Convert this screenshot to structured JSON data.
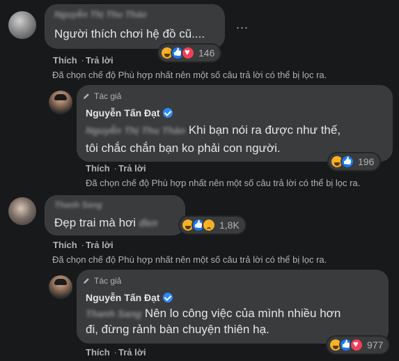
{
  "comments": [
    {
      "author": "Nguyễn Thị Thu Thảo",
      "text": "Người thích chơi hệ đồ cũ....",
      "reactions": [
        "haha",
        "like",
        "love"
      ],
      "reaction_count": "146",
      "actions": {
        "like": "Thích",
        "reply": "Trả lời"
      },
      "filter_note": "Đã chọn chế độ Phù hợp nhất nên một số câu trả lời có thể bị lọc ra.",
      "more": "...",
      "reply": {
        "badge": "Tác giả",
        "author": "Nguyễn Tấn Đạt",
        "mention": "Nguyễn Thị Thu Thảo",
        "text_line1": "Khi bạn nói ra được như thế,",
        "text_line2": "tôi chắc chắn bạn ko phải con người.",
        "reactions": [
          "haha",
          "like"
        ],
        "reaction_count": "196",
        "actions": {
          "like": "Thích",
          "reply": "Trả lời"
        },
        "filter_note": "Đã chọn chế độ Phù hợp nhất nên một số câu trả lời có thể bị lọc ra."
      }
    },
    {
      "author": "Thanh Sang",
      "text": "Đẹp trai mà hơi",
      "hidden_word": "đen",
      "reactions": [
        "haha",
        "like",
        "sad"
      ],
      "reaction_count": "1,8K",
      "actions": {
        "like": "Thích",
        "reply": "Trả lời"
      },
      "filter_note": "Đã chọn chế độ Phù hợp nhất nên một số câu trả lời có thể bị lọc ra.",
      "reply": {
        "badge": "Tác giả",
        "author": "Nguyễn Tấn Đạt",
        "mention": "Thanh Sang",
        "text_line1": "Nên lo công việc của mình nhiều hơn",
        "text_line2": "đi, đừng rảnh bàn chuyện thiên hạ.",
        "reactions": [
          "haha",
          "like",
          "love"
        ],
        "reaction_count": "977",
        "actions": {
          "like": "Thích",
          "reply": "Trả lời"
        }
      }
    }
  ],
  "colors": {
    "background": "#18191a",
    "bubble": "#3a3b3c",
    "text": "#e4e6eb",
    "secondary": "#b0b3b8",
    "verified": "#2d88ff"
  }
}
